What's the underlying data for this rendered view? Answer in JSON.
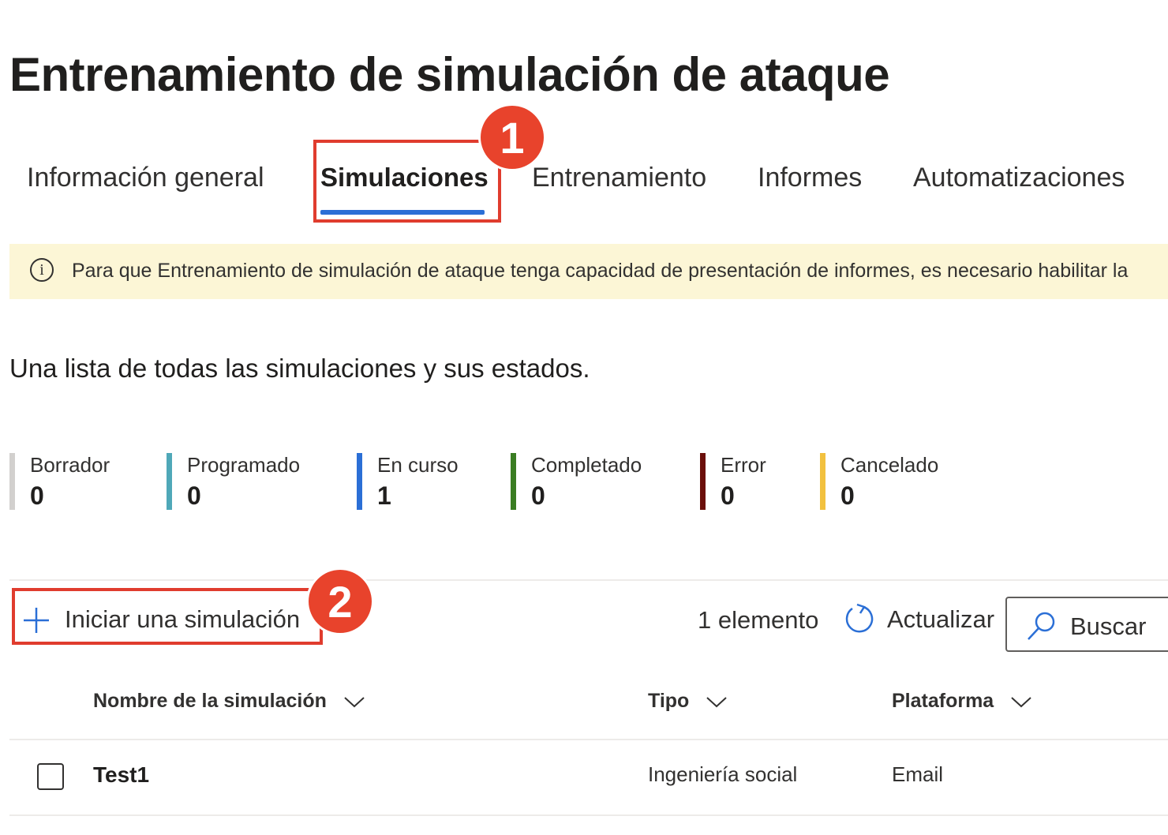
{
  "page": {
    "title": "Entrenamiento de simulación de ataque"
  },
  "tabs": [
    {
      "label": "Información general",
      "active": false
    },
    {
      "label": "Simulaciones",
      "active": true
    },
    {
      "label": "Entrenamiento",
      "active": false
    },
    {
      "label": "Informes",
      "active": false
    },
    {
      "label": "Automatizaciones",
      "active": false
    }
  ],
  "callouts": [
    {
      "number": "1"
    },
    {
      "number": "2"
    }
  ],
  "banner": {
    "icon": "info-icon",
    "text": "Para que Entrenamiento de simulación de ataque tenga capacidad de presentación de informes, es necesario habilitar la"
  },
  "description": "Una lista de todas las simulaciones y sus estados.",
  "statuses": [
    {
      "label": "Borrador",
      "count": "0",
      "color": "#d2d0ce"
    },
    {
      "label": "Programado",
      "count": "0",
      "color": "#4fa8b8"
    },
    {
      "label": "En curso",
      "count": "1",
      "color": "#2b6fd6"
    },
    {
      "label": "Completado",
      "count": "0",
      "color": "#3a7d22"
    },
    {
      "label": "Error",
      "count": "0",
      "color": "#6b0f0a"
    },
    {
      "label": "Cancelado",
      "count": "0",
      "color": "#f2c13f"
    }
  ],
  "toolbar": {
    "start_label": "Iniciar una simulación",
    "item_count": "1 elemento",
    "refresh_label": "Actualizar",
    "search_placeholder": "Buscar"
  },
  "table": {
    "columns": [
      "Nombre de la simulación",
      "Tipo",
      "Plataforma"
    ],
    "rows": [
      {
        "name": "Test1",
        "type": "Ingeniería social",
        "platform": "Email"
      }
    ]
  },
  "colors": {
    "accent": "#2b6fd6",
    "callout": "#e8432c",
    "banner_bg": "#fcf6d6"
  }
}
